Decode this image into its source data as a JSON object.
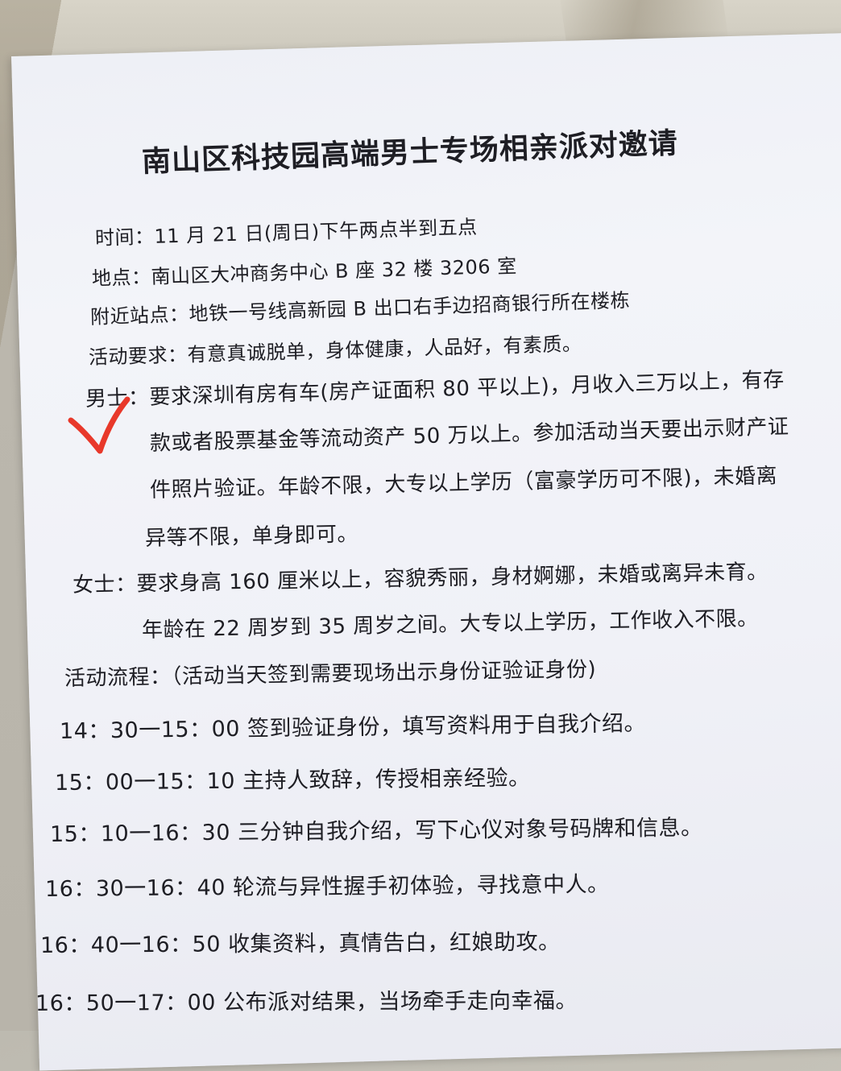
{
  "document": {
    "title": "南山区科技园高端男士专场相亲派对邀请",
    "info_lines": [
      "时间：11 月 21 日(周日)下午两点半到五点",
      "地点：南山区大冲商务中心 B 座 32 楼 3206 室",
      "附近站点：地铁一号线高新园 B 出口右手边招商银行所在楼栋",
      "活动要求：有意真诚脱单，身体健康，人品好，有素质。"
    ],
    "men_requirements": [
      "男士：要求深圳有房有车(房产证面积 80 平以上)，月收入三万以上，有存",
      "款或者股票基金等流动资产 50 万以上。参加活动当天要出示财产证",
      "件照片验证。年龄不限，大专以上学历（富豪学历可不限)，未婚离",
      "异等不限，单身即可。"
    ],
    "women_requirements": [
      "女士：要求身高 160 厘米以上，容貌秀丽，身材婀娜，未婚或离异未育。",
      "年龄在 22 周岁到 35 周岁之间。大专以上学历，工作收入不限。"
    ],
    "schedule_header": "活动流程：（活动当天签到需要现场出示身份证验证身份)",
    "schedule": [
      "14：30一15：00 签到验证身份，填写资料用于自我介绍。",
      "15：00一15：10 主持人致辞，传授相亲经验。",
      "15：10一16：30 三分钟自我介绍，写下心仪对象号码牌和信息。",
      "16：30一16：40 轮流与异性握手初体验，寻找意中人。",
      "16：40一16：50   收集资料，真情告白，红娘助攻。",
      "16：50一17：00   公布派对结果，当场牵手走向幸福。"
    ]
  },
  "colors": {
    "ink": "#1e1e24",
    "check_mark": "#e8382a",
    "paper": "#f0f1f7"
  },
  "icons": {
    "check_mark": "red-check-mark-icon"
  }
}
